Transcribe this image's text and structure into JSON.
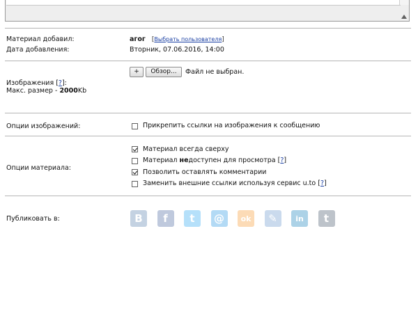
{
  "meta": {
    "added_by_label": "Материал добавил:",
    "added_by_value": "агог",
    "choose_user_link": "Выбрать пользователя",
    "date_label": "Дата добавления:",
    "date_value": "Вторник, 07.06.2016, 14:00"
  },
  "images": {
    "label": "Изображения",
    "help": "?",
    "max_size_prefix": "Макс. размер - ",
    "max_size_value": "2000",
    "max_size_unit": "Kb",
    "add_button": "+",
    "browse_button": "Обзор...",
    "no_file_text": "Файл не выбран."
  },
  "image_options": {
    "label": "Опции изображений:",
    "attach_links": {
      "label": "Прикрепить ссылки на изображения к сообщению",
      "checked": false
    }
  },
  "material_options": {
    "label": "Опции материала:",
    "items": [
      {
        "label": "Материал всегда сверху",
        "checked": true
      },
      {
        "label_prefix": "Материал ",
        "label_bold": "не",
        "label_suffix": "доступен для просмотра",
        "help": "?",
        "checked": false
      },
      {
        "label": "Позволить оставлять комментарии",
        "checked": true
      },
      {
        "label": "Заменить внешние ссылки используя сервис u.to",
        "help": "?",
        "checked": false
      }
    ]
  },
  "publish": {
    "label": "Публиковать в:",
    "networks": [
      {
        "icon": "vkontakte-icon",
        "glyph": "В",
        "color": "#4a76a8"
      },
      {
        "icon": "facebook-icon",
        "glyph": "f",
        "color": "#3b5998"
      },
      {
        "icon": "twitter-icon",
        "glyph": "t",
        "color": "#1da1f2"
      },
      {
        "icon": "mailru-icon",
        "glyph": "@",
        "color": "#168de2"
      },
      {
        "icon": "odnoklassniki-icon",
        "glyph": "ok",
        "color": "#f7931e"
      },
      {
        "icon": "livejournal-icon",
        "glyph": "✎",
        "color": "#5d8fc9"
      },
      {
        "icon": "linkedin-icon",
        "glyph": "in",
        "color": "#0077b5"
      },
      {
        "icon": "tumblr-icon",
        "glyph": "t",
        "color": "#36465d"
      }
    ]
  }
}
